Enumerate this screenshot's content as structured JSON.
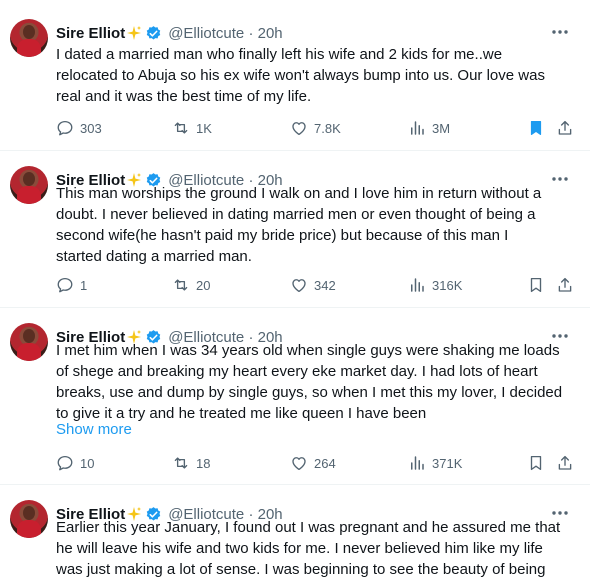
{
  "tweets": [
    {
      "name": "Sire Elliot",
      "handle": "@Elliotcute",
      "time": "20h",
      "text": "I dated a married man who finally left his wife and 2 kids for me..we\nrelocated to Abuja so his ex wife won't always bump into us.  Our love was\nreal and it was the best time of my life.",
      "replies": "303",
      "retweets": "1K",
      "likes": "7.8K",
      "views": "3M",
      "bookmarked": true
    },
    {
      "name": "Sire Elliot",
      "handle": "@Elliotcute",
      "time": "20h",
      "text": "This man worships the ground I walk on and I love him in return without a\ndoubt. I never believed in dating married men or even thought of being a\nsecond wife(he hasn't paid my bride price) but because of this man I\nstarted dating a married man.",
      "replies": "1",
      "retweets": "20",
      "likes": "342",
      "views": "316K",
      "bookmarked": false
    },
    {
      "name": "Sire Elliot",
      "handle": "@Elliotcute",
      "time": "20h",
      "text": "I met him when I was 34 years old when single guys were shaking me loads\nof shege and breaking my heart every eke market day. I had lots of heart\nbreaks, use and dump by single guys, so when I met this my lover, I decided\nto give it a try and he treated me like queen I have been",
      "show_more": "Show more",
      "replies": "10",
      "retweets": "18",
      "likes": "264",
      "views": "371K",
      "bookmarked": false
    },
    {
      "name": "Sire Elliot",
      "handle": "@Elliotcute",
      "time": "20h",
      "text": "Earlier this year January, I found out I was pregnant and he assured me that\nhe will leave his wife and two kids for me. I never believed him like my life\nwas just making a lot of sense. I was beginning to see the beauty of being"
    }
  ],
  "sparkle_emoji": "✨",
  "separator": "·",
  "colors": {
    "accent": "#1d9bf0",
    "muted": "#536471",
    "text": "#0f1419",
    "divider": "#eff3f4"
  },
  "icons": [
    "reply-icon",
    "retweet-icon",
    "like-icon",
    "views-icon",
    "bookmark-icon",
    "share-icon",
    "more-icon",
    "verified-badge-icon",
    "sparkle-icon"
  ]
}
